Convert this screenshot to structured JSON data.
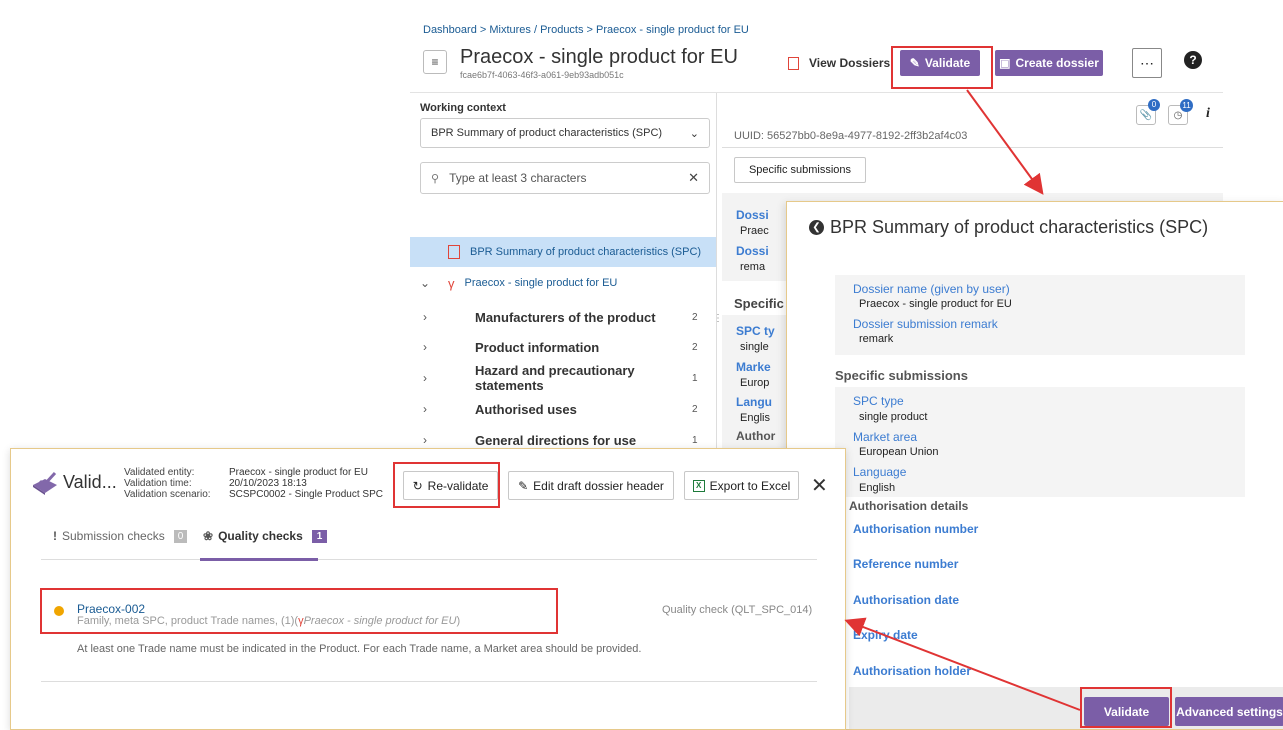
{
  "header": {
    "breadcrumb": "Dashboard > Mixtures / Products > Praecox - single product for EU",
    "title": "Praecox - single product for EU",
    "subtitle_id": "fcae6b7f-4063-46f3-a061-9eb93adb051c",
    "view_dossiers": "View Dossiers",
    "validate": "Validate",
    "create_dossier": "Create dossier",
    "more": "⋯",
    "help": "?"
  },
  "left_panel": {
    "working_context_label": "Working context",
    "working_context_value": "BPR Summary of product characteristics (SPC)",
    "search_placeholder": "Type at least 3 characters",
    "tree": [
      {
        "label": "BPR Summary of product characteristics (SPC)"
      },
      {
        "label": "Praecox - single product for EU"
      },
      {
        "label": "Manufacturers of the product",
        "count": "2"
      },
      {
        "label": "Product information",
        "count": "2"
      },
      {
        "label": "Hazard and precautionary statements",
        "count": "1"
      },
      {
        "label": "Authorised uses",
        "count": "2"
      },
      {
        "label": "General directions for use",
        "count": "1"
      }
    ]
  },
  "right_panel": {
    "badge_attach": "0",
    "badge_history": "11",
    "info": "i",
    "uuid": "UUID: 56527bb0-8e9a-4977-8192-2ff3b2af4c03",
    "specific_submissions_btn": "Specific submissions",
    "partial_labels": [
      "Dossi",
      "Praec",
      "Dossi",
      "rema",
      "Specific",
      "SPC ty",
      "single",
      "Marke",
      "Europ",
      "Langu",
      "Englis",
      "Author"
    ]
  },
  "spc_panel": {
    "title": "BPR Summary of product characteristics (SPC)",
    "dossier_name_label": "Dossier name (given by user)",
    "dossier_name_value": "Praecox - single product for EU",
    "remark_label": "Dossier submission remark",
    "remark_value": "remark",
    "specific_submissions": "Specific submissions",
    "spc_type_label": "SPC type",
    "spc_type_value": "single product",
    "market_area_label": "Market area",
    "market_area_value": "European Union",
    "language_label": "Language",
    "language_value": "English",
    "authorisation_details": "Authorisation details",
    "authorisation_number": "Authorisation number",
    "reference_number": "Reference number",
    "authorisation_date": "Authorisation date",
    "expiry_date": "Expiry date",
    "authorisation_holder": "Authorisation holder",
    "validate": "Validate",
    "advanced_settings": "Advanced settings"
  },
  "validation": {
    "title": "Valid...",
    "validated_entity_label": "Validated entity:",
    "validated_entity_value": "Praecox - single product for EU",
    "validation_time_label": "Validation time:",
    "validation_time_value": "20/10/2023 18:13",
    "validation_scenario_label": "Validation scenario:",
    "validation_scenario_value": "SCSPC0002 - Single Product SPC",
    "revalidate": "Re-validate",
    "edit_header": "Edit draft dossier header",
    "export": "Export to Excel",
    "close": "✕",
    "tab_submission": "Submission checks",
    "tab_submission_count": "0",
    "tab_quality": "Quality checks",
    "tab_quality_count": "1",
    "item_title": "Praecox-002",
    "item_subtitle_prefix": "Family, meta SPC, product Trade names, (1)(",
    "item_subtitle_link": "Praecox - single product for EU",
    "item_subtitle_suffix": ")",
    "item_type": "Quality check (QLT_SPC_014)",
    "item_message": "At least one Trade name must be indicated in the Product. For each Trade name, a Market area should be provided."
  },
  "colors": {
    "accent": "#7b5ea7",
    "highlight": "#e03434",
    "selected_row": "#c8e0f7",
    "warning": "#f0a500"
  }
}
